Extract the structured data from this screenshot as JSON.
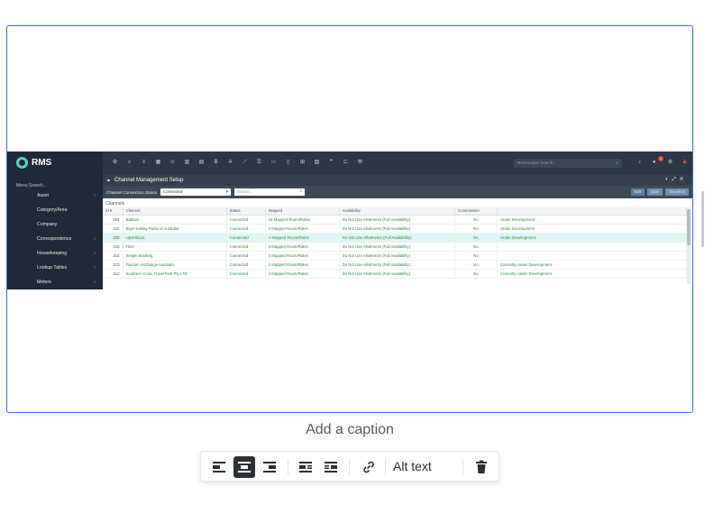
{
  "screenshot": {
    "sidebar": {
      "logo": "RMS",
      "menu_search": "Menu Search...",
      "items": [
        {
          "label": "Asset"
        },
        {
          "label": "Category/Area"
        },
        {
          "label": "Company"
        },
        {
          "label": "Correspondence"
        },
        {
          "label": "Housekeeping"
        },
        {
          "label": "Lookup Tables"
        },
        {
          "label": "Meters"
        }
      ]
    },
    "topbar": {
      "reservation_search_placeholder": "Reservation Search...",
      "notification_count": "1"
    },
    "window": {
      "title": "Channel Management Setup",
      "status_label": "Channel Connection Status",
      "status_value": "Connected",
      "search_placeholder": "Search...",
      "buttons": {
        "edit": "Edit",
        "save": "Save",
        "save_exit": "Save/Exit"
      }
    },
    "grid": {
      "section_label": "Channels",
      "columns": [
        "Id",
        "Channel",
        "Status",
        "Mapped",
        "Availability",
        "Commission",
        ""
      ],
      "rows": [
        {
          "id": "324",
          "channel": "Babuun",
          "status": "Connected",
          "mapped": "15 Mapped Room/Rates",
          "availability": "Do Not Use Allotments (Full Availability)",
          "commission": "No",
          "note": "Under Development"
        },
        {
          "id": "322",
          "channel": "Big4 Holiday Parks of Australia",
          "status": "Connected",
          "mapped": "2 Mapped Room/Rates",
          "availability": "Do Not Use Allotments (Full Availability)",
          "commission": "No",
          "note": "Under Development"
        },
        {
          "id": "320",
          "channel": "UpselGuru",
          "status": "Connected",
          "mapped": "1 Mapped Room/Rates",
          "availability": "Do Not Use Allotments (Full Availability)",
          "commission": "No",
          "note": "Under Development"
        },
        {
          "id": "315",
          "channel": "Tiket",
          "status": "Connected",
          "mapped": "3 Mapped Room/Rates",
          "availability": "Do Not Use Allotments (Full Availability)",
          "commission": "No",
          "note": ""
        },
        {
          "id": "314",
          "channel": "Simple Booking",
          "status": "Connected",
          "mapped": "0 Mapped Room/Rates",
          "availability": "Do Not Use Allotments (Full Availability)",
          "commission": "No",
          "note": ""
        },
        {
          "id": "313",
          "channel": "Tourism eXchange Australia",
          "status": "Connected",
          "mapped": "2 Mapped Room/Rates",
          "availability": "Do Not Use Allotments (Full Availability)",
          "commission": "No",
          "note": "Currently Under Development"
        },
        {
          "id": "312",
          "channel": "Southern Cross TravelTech Pty LTD",
          "status": "Connected",
          "mapped": "4 Mapped Room/Rates",
          "availability": "Do Not Use Allotments (Full Availability)",
          "commission": "No",
          "note": "Currently Under Development"
        }
      ],
      "selected_row": 2
    }
  },
  "caption": {
    "placeholder": "Add a caption"
  },
  "image_toolbar": {
    "buttons": [
      {
        "icon": "align-left-icon"
      },
      {
        "icon": "align-center-icon",
        "active": true
      },
      {
        "icon": "align-right-icon"
      },
      {
        "icon": "wrap-left-icon"
      },
      {
        "icon": "wrap-right-icon"
      },
      {
        "icon": "link-icon"
      }
    ],
    "alt_text_label": "Alt text",
    "delete_icon": "trash-icon"
  },
  "colors": {
    "frame_border": "#3b6fd1",
    "toolbar_active": "#2d3239",
    "status_green": "#2e8b3a",
    "rms_teal": "#5ad0c8"
  }
}
